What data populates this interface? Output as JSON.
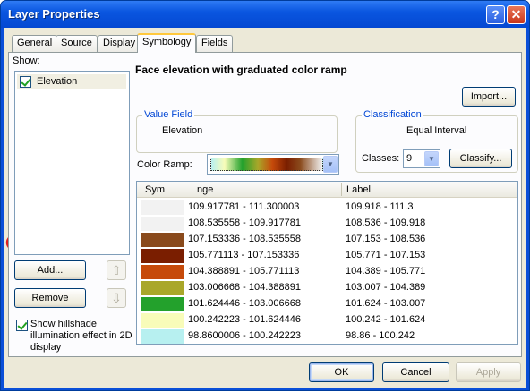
{
  "window": {
    "title": "Layer Properties",
    "help_glyph": "?",
    "close_glyph": "✕"
  },
  "tabs": [
    {
      "label": "General"
    },
    {
      "label": "Source"
    },
    {
      "label": "Display"
    },
    {
      "label": "Symbology",
      "active": true
    },
    {
      "label": "Fields"
    }
  ],
  "show": {
    "label": "Show:",
    "items": [
      {
        "label": "Elevation",
        "checked": true
      }
    ],
    "add_label": "Add...",
    "remove_label": "Remove",
    "up_glyph": "⇧",
    "down_glyph": "⇩"
  },
  "hillshade": {
    "checked": true,
    "label": "Show hillshade illumination effect in 2D display"
  },
  "main": {
    "heading": "Face elevation with graduated color ramp",
    "import_label": "Import..."
  },
  "value_field": {
    "title": "Value Field",
    "value": "Elevation"
  },
  "classification": {
    "title": "Classification",
    "method": "Equal Interval",
    "classes_label": "Classes:",
    "classes_value": "9",
    "classify_label": "Classify..."
  },
  "color_ramp": {
    "label": "Color Ramp:"
  },
  "table": {
    "headers": {
      "symbol": "Sym",
      "range": "nge",
      "label": "Label"
    },
    "rows": [
      {
        "range": "109.917781 - 111.300003",
        "label": "109.918 - 111.3",
        "color": "#f2f2f2"
      },
      {
        "range": "108.535558 - 109.917781",
        "label": "108.536 - 109.918",
        "color": "#f2f2f2"
      },
      {
        "range": "107.153336 - 108.535558",
        "label": "107.153 - 108.536",
        "color": "#8a4a1c"
      },
      {
        "range": "105.771113 - 107.153336",
        "label": "105.771 - 107.153",
        "color": "#7a1e00"
      },
      {
        "range": "104.388891 - 105.771113",
        "label": "104.389 - 105.771",
        "color": "#c64a0a"
      },
      {
        "range": "103.006668 - 104.388891",
        "label": "103.007 - 104.389",
        "color": "#a9a72a"
      },
      {
        "range": "101.624446 - 103.006668",
        "label": "101.624 - 103.007",
        "color": "#23a12c"
      },
      {
        "range": "100.242223 - 101.624446",
        "label": "100.242 - 101.624",
        "color": "#f8fcb9"
      },
      {
        "range": "98.8600006 - 100.242223",
        "label": "98.86 - 100.242",
        "color": "#b7f0f0"
      }
    ]
  },
  "footer": {
    "ok_label": "OK",
    "cancel_label": "Cancel",
    "apply_label": "Apply"
  },
  "overlay": {
    "arrow_color": "#4a7ac0",
    "arrow_outline": "#e02020",
    "circle_color": "#e02020"
  }
}
